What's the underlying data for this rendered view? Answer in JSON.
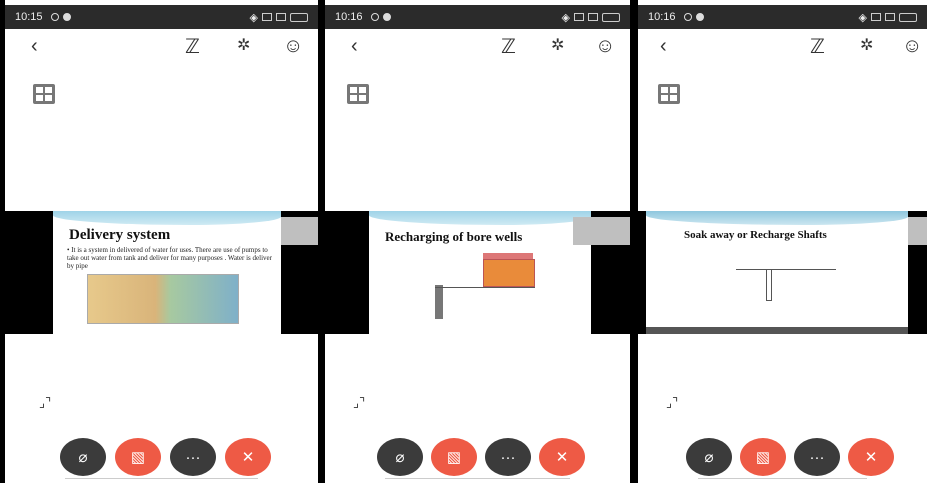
{
  "phones": [
    {
      "status": {
        "time": "10:15"
      },
      "slide": {
        "title": "Delivery system",
        "body": "• It is a system in delivered of water for uses. There are use of pumps to take out water from tank and deliver for many purposes . Water is deliver by pipe"
      }
    },
    {
      "status": {
        "time": "10:16"
      },
      "slide": {
        "title": "Recharging of bore wells"
      }
    },
    {
      "status": {
        "time": "10:16"
      },
      "slide": {
        "title": "Soak away or Recharge Shafts"
      }
    }
  ],
  "icons": {
    "back": "back-chevron-icon",
    "annotate": "annotate-squiggle-icon",
    "bluetooth": "bluetooth-icon",
    "participants": "participants-icon",
    "layout": "grid-layout-icon",
    "expand": "expand-icon",
    "mic": "mic-muted-icon",
    "video": "video-off-icon",
    "more": "more-icon",
    "hangup": "hang-up-icon"
  },
  "colors": {
    "accent_red": "#ee5a45",
    "dark_button": "#3b3b3b",
    "status_bar": "#2b2b2b"
  },
  "controls": {
    "more_label": "···"
  }
}
